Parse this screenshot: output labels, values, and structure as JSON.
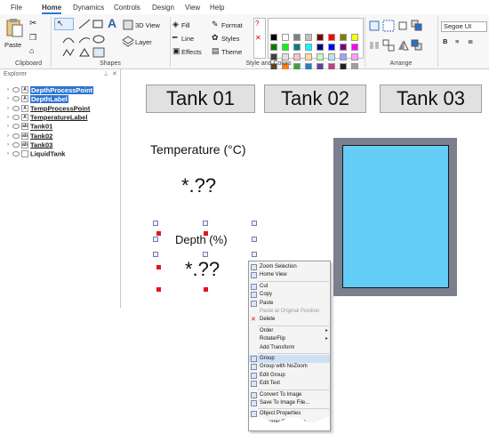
{
  "menu": {
    "items": [
      "File",
      "Home",
      "Dynamics",
      "Controls",
      "Design",
      "View",
      "Help"
    ],
    "active": "Home"
  },
  "ribbon": {
    "clipboard": {
      "paste_label": "Paste",
      "group_label": "Clipboard"
    },
    "shapes": {
      "view3d_label": "3D View",
      "layer_label": "Layer",
      "group_label": "Shapes"
    },
    "style": {
      "fill_label": "Fill",
      "line_label": "Line",
      "effects_label": "Effects",
      "format_label": "Format",
      "styles_label": "Styles",
      "theme_label": "Theme",
      "group_label": "Style and Colors"
    },
    "arrange": {
      "group_label": "Arrange"
    },
    "font": {
      "font_value": "Segoe UI"
    },
    "palette": [
      "#000000",
      "#ffffff",
      "#808080",
      "#c0c0c0",
      "#800000",
      "#ff0000",
      "#808000",
      "#ffff00",
      "#008000",
      "#00ff00",
      "#008080",
      "#00ffff",
      "#000080",
      "#0000ff",
      "#800080",
      "#ff00ff",
      "#404040",
      "#e0e0e0",
      "#ffc0c0",
      "#ffe0a0",
      "#c0ffc0",
      "#c0e0ff",
      "#a0a0ff",
      "#ffa0ff",
      "#604020",
      "#ff8000",
      "#40a040",
      "#2080c0",
      "#6040a0",
      "#c04080",
      "#202020",
      "#a0a0a0"
    ]
  },
  "explorer": {
    "title": "Explorer",
    "items": [
      {
        "label": "DepthProcessPoint",
        "tag": "A",
        "selected": true
      },
      {
        "label": "DepthLabel",
        "tag": "A",
        "selected": true
      },
      {
        "label": "TempProcessPoint",
        "tag": "A",
        "selected": false
      },
      {
        "label": "TemperatureLabel",
        "tag": "A",
        "selected": false
      },
      {
        "label": "Tank01",
        "tag": "ab",
        "selected": false
      },
      {
        "label": "Tank02",
        "tag": "ab",
        "selected": false
      },
      {
        "label": "Tank03",
        "tag": "ab",
        "selected": false
      },
      {
        "label": "LiquidTank",
        "tag": "",
        "selected": false
      }
    ]
  },
  "canvas": {
    "tanks": [
      "Tank 01",
      "Tank 02",
      "Tank 03"
    ],
    "temperature_label": "Temperature (°C)",
    "temperature_value": "*.??",
    "depth_label": "Depth (%)",
    "depth_value": "*.??"
  },
  "context_menu": {
    "items": [
      {
        "label": "Zoom Selection",
        "disabled": false,
        "icon": "zoom-icon"
      },
      {
        "label": "Home View",
        "disabled": false,
        "icon": "home-icon"
      },
      {
        "label": "Cut",
        "disabled": false,
        "icon": "cut-icon"
      },
      {
        "label": "Copy",
        "disabled": false,
        "icon": "copy-icon"
      },
      {
        "label": "Paste",
        "disabled": false,
        "icon": "paste-icon"
      },
      {
        "label": "Paste at Original Position",
        "disabled": true,
        "icon": ""
      },
      {
        "label": "Delete",
        "disabled": false,
        "icon": "delete-icon"
      },
      {
        "label": "Order",
        "disabled": false,
        "icon": "",
        "submenu": true
      },
      {
        "label": "Rotate/Flip",
        "disabled": false,
        "icon": "",
        "submenu": true
      },
      {
        "label": "Add Transform",
        "disabled": false,
        "icon": ""
      },
      {
        "label": "Group",
        "disabled": false,
        "icon": "group-icon",
        "highlighted": true
      },
      {
        "label": "Group with NoZoom",
        "disabled": false,
        "icon": "group-nozoom-icon"
      },
      {
        "label": "Edit Group",
        "disabled": false,
        "icon": "edit-group-icon"
      },
      {
        "label": "Edit Text",
        "disabled": false,
        "icon": "edit-text-icon"
      },
      {
        "label": "Convert To Image",
        "disabled": false,
        "icon": "image-icon"
      },
      {
        "label": "Save To Image File...",
        "disabled": false,
        "icon": "save-icon"
      },
      {
        "label": "Object Properties",
        "disabled": false,
        "icon": "properties-icon"
      },
      {
        "label": "Dynamic Properties",
        "disabled": false,
        "icon": "dynamics-icon"
      }
    ]
  }
}
